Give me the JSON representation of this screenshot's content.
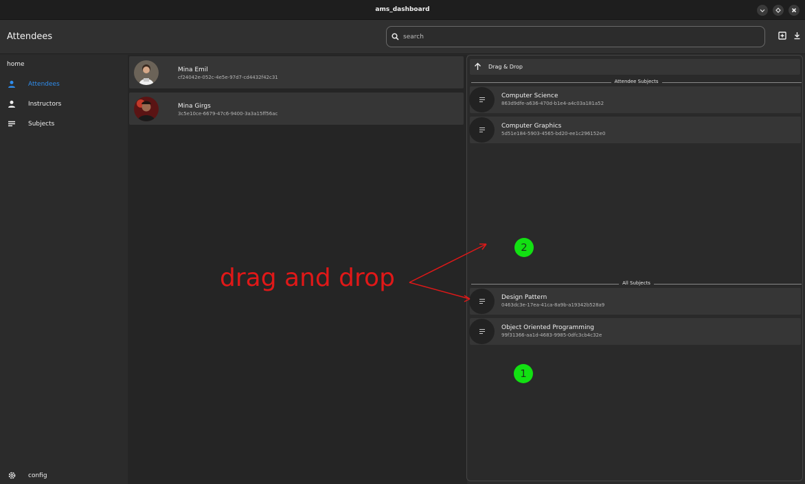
{
  "window": {
    "title": "ams_dashboard"
  },
  "appbar": {
    "title": "Attendees",
    "search": {
      "placeholder": "search",
      "value": ""
    }
  },
  "sidebar": {
    "home_label": "home",
    "items": [
      {
        "label": "Attendees",
        "icon": "person-icon",
        "active": true
      },
      {
        "label": "Instructors",
        "icon": "person-icon",
        "active": false
      },
      {
        "label": "Subjects",
        "icon": "list-icon",
        "active": false
      }
    ],
    "config_label": "config"
  },
  "attendees": [
    {
      "name": "Mina Emil",
      "id": "cf24042e-052c-4e5e-97d7-cd4432f42c31"
    },
    {
      "name": "Mina Girgs",
      "id": "3c5e10ce-6679-47c6-9400-3a3a15ff56ac"
    }
  ],
  "subjects_panel": {
    "header_label": "Drag & Drop",
    "attendee_subjects_label": "Attendee Subjects",
    "all_subjects_label": "All Subjects",
    "attendee_subjects": [
      {
        "name": "Computer Science",
        "id": "863d9dfe-a636-470d-b1e4-a4c03a181a52"
      },
      {
        "name": "Computer Graphics",
        "id": "5d51e184-5903-4565-bd20-ee1c296152e0"
      }
    ],
    "all_subjects": [
      {
        "name": "Design Pattern",
        "id": "0463dc3e-17ea-41ca-8a9b-a19342b528a9"
      },
      {
        "name": "Object Oriented Programming",
        "id": "99f31366-aa1d-4683-9985-0dfc3cb4c32e"
      }
    ]
  },
  "annotations": {
    "text": "drag and drop",
    "badge_1": "1",
    "badge_2": "2",
    "color": "#e01818",
    "badge_color": "#12e012"
  },
  "colors": {
    "accent": "#2f8ded",
    "card": "#363636"
  }
}
